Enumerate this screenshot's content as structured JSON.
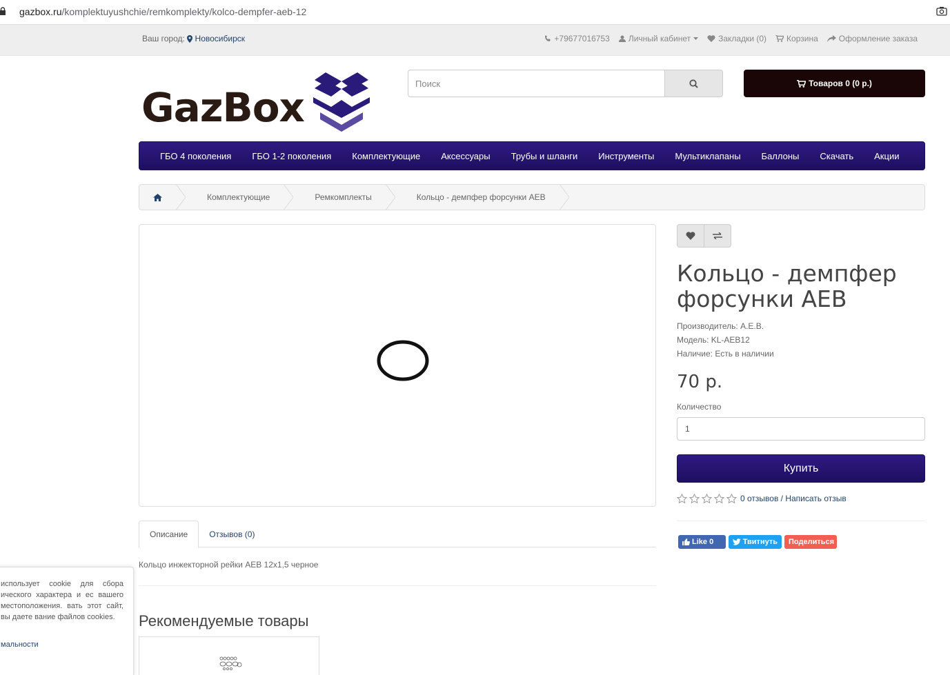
{
  "browser": {
    "url_host": "gazbox.ru",
    "url_path": "/komplektuyushchie/remkomplekty/kolco-dempfer-aeb-12"
  },
  "topbar": {
    "city_label": "Ваш город:",
    "city_value": "Новосибирск",
    "phone": "+79677016753",
    "account": "Личный кабинет",
    "bookmarks": "Закладки (0)",
    "cart": "Корзина",
    "checkout": "Оформление заказа"
  },
  "logo": {
    "text": "GazBox"
  },
  "search": {
    "placeholder": "Поиск"
  },
  "cart_button": {
    "label": "Товаров 0 (0 р.)"
  },
  "menu": [
    "ГБО 4 поколения",
    "ГБО 1-2 поколения",
    "Комплектующие",
    "Аксессуары",
    "Трубы и шланги",
    "Инструменты",
    "Мультиклапаны",
    "Баллоны",
    "Скачать",
    "Акции"
  ],
  "breadcrumb": [
    "Комплектующие",
    "Ремкомплекты",
    "Кольцо - демпфер форсунки AEB"
  ],
  "product": {
    "title": "Кольцо - демпфер форсунки AEB",
    "manufacturer": "Производитель: A.E.B.",
    "model": "Модель: KL-AEB12",
    "availability": "Наличие: Есть в наличии",
    "price": "70 р.",
    "qty_label": "Количество",
    "qty_value": "1",
    "buy_label": "Купить",
    "reviews_link": "0 отзывов / Написать отзыв",
    "rating": 0
  },
  "tabs": [
    {
      "label": "Описание",
      "active": true
    },
    {
      "label": "Отзывов (0)",
      "active": false
    }
  ],
  "description": "Кольцо инжекторной рейки AEB 12х1,5  черное",
  "recommended_title": "Рекомендуемые товары",
  "social": {
    "fb": "Like 0",
    "tw": "Твитнуть",
    "share": "Поделиться"
  },
  "cookie": {
    "text": "использует cookie для сбора ического характера и ес вашего местоположения. вать этот сайт, вы даете вание файлов cookies.",
    "link": "мальности"
  },
  "colors": {
    "menu_bg": "#2a1878",
    "cart_bg": "#1a0606",
    "link": "#23436b"
  }
}
